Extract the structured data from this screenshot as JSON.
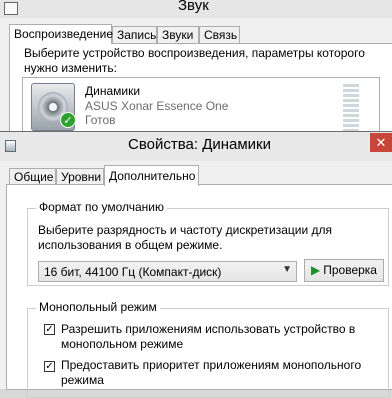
{
  "back_window": {
    "title": "Звук",
    "tabs": [
      {
        "label": "Воспроизведение",
        "active": true
      },
      {
        "label": "Запись",
        "active": false
      },
      {
        "label": "Звуки",
        "active": false
      },
      {
        "label": "Связь",
        "active": false
      }
    ],
    "description": "Выберите устройство воспроизведения, параметры которого нужно изменить:",
    "device": {
      "name": "Динамики",
      "model": "ASUS Xonar Essence One",
      "status": "Готов",
      "icon": "speaker-icon"
    }
  },
  "front_window": {
    "title": "Свойства: Динамики",
    "close_glyph": "✕",
    "tabs": [
      {
        "label": "Общие",
        "active": false
      },
      {
        "label": "Уровни",
        "active": false
      },
      {
        "label": "Дополнительно",
        "active": true
      }
    ],
    "default_format": {
      "group_label": "Формат по умолчанию",
      "description": "Выберите разрядность и частоту дискретизации для использования в общем режиме.",
      "selected_format": "16 бит, 44100 Гц (Компакт-диск)",
      "test_button": "Проверка"
    },
    "exclusive_mode": {
      "group_label": "Монопольный режим",
      "allow_exclusive": {
        "label": "Разрешить приложениям использовать устройство в монопольном режиме",
        "checked": true
      },
      "give_priority": {
        "label": "Предоставить приоритет приложениям монопольного режима",
        "checked": true
      }
    }
  },
  "colors": {
    "test_play_icon": "#1f8f2c",
    "close_button": "#c7463a"
  }
}
